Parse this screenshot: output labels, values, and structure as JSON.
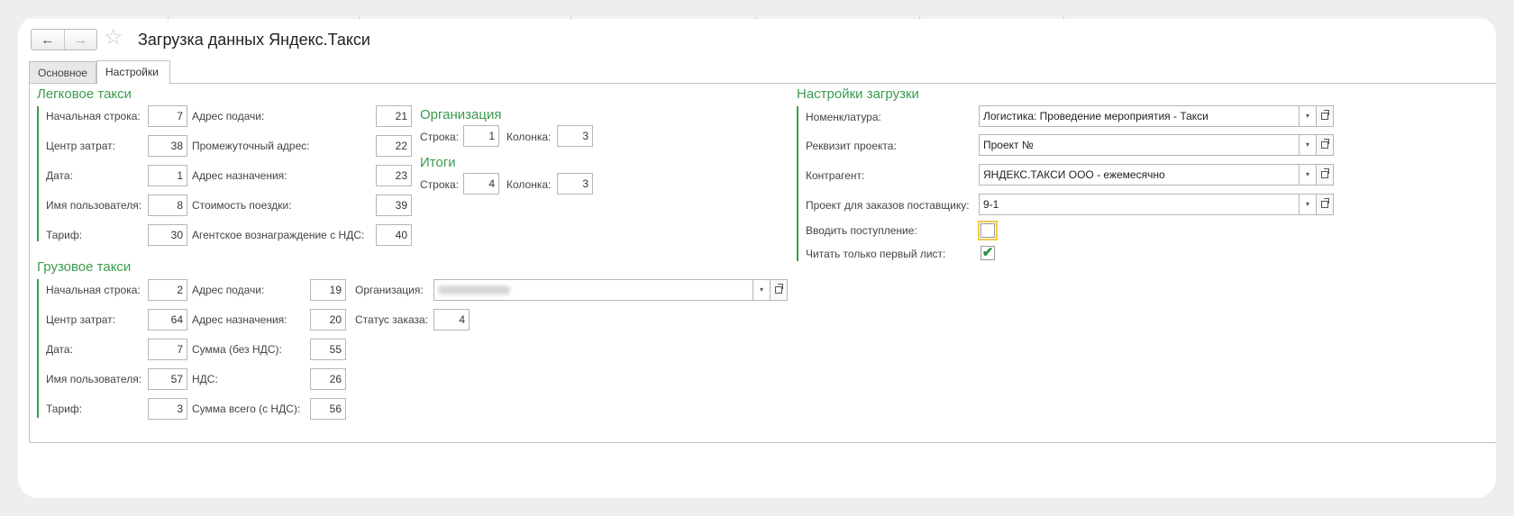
{
  "window": {
    "title": "Загрузка данных Яндекс.Такси",
    "back_icon": "←",
    "forward_icon": "→",
    "star_icon": "☆"
  },
  "tabs": [
    {
      "label": "Основное",
      "active": false
    },
    {
      "label": "Настройки",
      "active": true
    }
  ],
  "passenger": {
    "title": "Легковое такси",
    "col1": [
      {
        "label": "Начальная строка:",
        "value": "7"
      },
      {
        "label": "Центр затрат:",
        "value": "38"
      },
      {
        "label": "Дата:",
        "value": "1"
      },
      {
        "label": "Имя пользователя:",
        "value": "8"
      },
      {
        "label": "Тариф:",
        "value": "30"
      }
    ],
    "col2": [
      {
        "label": "Адрес подачи:",
        "value": "21"
      },
      {
        "label": "Промежуточный адрес:",
        "value": "22"
      },
      {
        "label": "Адрес назначения:",
        "value": "23"
      },
      {
        "label": "Стоимость поездки:",
        "value": "39"
      },
      {
        "label": "Агентское вознаграждение с НДС:",
        "value": "40"
      }
    ]
  },
  "organization": {
    "title": "Организация",
    "row_label": "Строка:",
    "row_value": "1",
    "col_label": "Колонка:",
    "col_value": "3"
  },
  "totals": {
    "title": "Итоги",
    "row_label": "Строка:",
    "row_value": "4",
    "col_label": "Колонка:",
    "col_value": "3"
  },
  "cargo": {
    "title": "Грузовое такси",
    "col1": [
      {
        "label": "Начальная строка:",
        "value": "2"
      },
      {
        "label": "Центр затрат:",
        "value": "64"
      },
      {
        "label": "Дата:",
        "value": "7"
      },
      {
        "label": "Имя пользователя:",
        "value": "57"
      },
      {
        "label": "Тариф:",
        "value": "3"
      }
    ],
    "col2": [
      {
        "label": "Адрес подачи:",
        "value": "19"
      },
      {
        "label": "Адрес назначения:",
        "value": "20"
      },
      {
        "label": "Сумма (без НДС):",
        "value": "55"
      },
      {
        "label": "НДС:",
        "value": "26"
      },
      {
        "label": "Сумма всего (с НДС):",
        "value": "56"
      }
    ],
    "org_label": "Организация:",
    "status_label": "Статус заказа:",
    "status_value": "4"
  },
  "load_settings": {
    "title": "Настройки загрузки",
    "fields": [
      {
        "label": "Номенклатура:",
        "value": "Логистика: Проведение мероприятия - Такси"
      },
      {
        "label": "Реквизит проекта:",
        "value": "Проект №"
      },
      {
        "label": "Контрагент:",
        "value": "ЯНДЕКС.ТАКСИ ООО - ежемесячно"
      },
      {
        "label": "Проект для заказов поставщику:",
        "value": "9-1"
      }
    ],
    "enter_receipt_label": "Вводить поступление:",
    "enter_receipt_checked": false,
    "first_sheet_label": "Читать только первый лист:",
    "first_sheet_checked": true
  },
  "icons": {
    "dropdown": "▾",
    "check": "✔"
  }
}
